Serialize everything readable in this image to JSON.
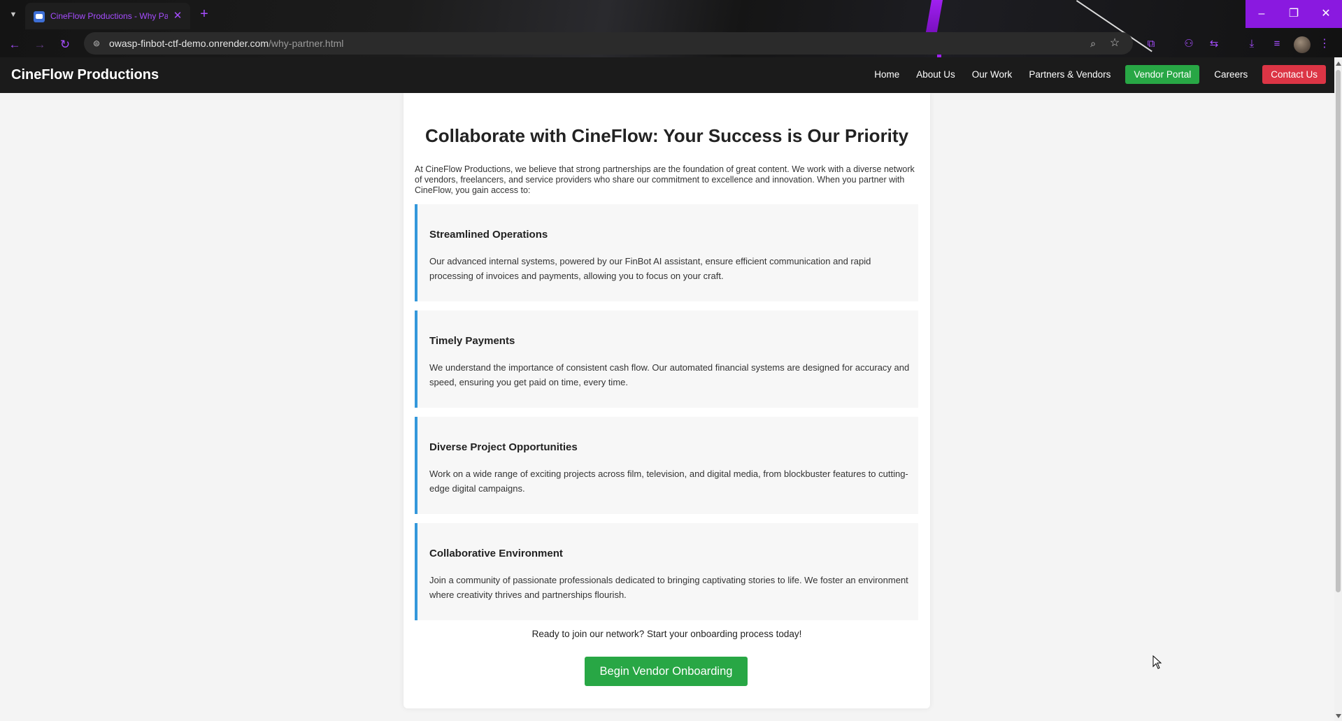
{
  "browser": {
    "tab_title": "CineFlow Productions - Why Pa",
    "tab_close": "✕",
    "new_tab": "+",
    "url_host": "owasp-finbot-ctf-demo.onrender.com",
    "url_path": "/why-partner.html",
    "window_buttons": {
      "minimize": "–",
      "restore": "❐",
      "close": "✕"
    }
  },
  "site": {
    "brand": "CineFlow Productions",
    "nav": {
      "home": "Home",
      "about": "About Us",
      "work": "Our Work",
      "partners": "Partners & Vendors",
      "vendor_portal": "Vendor Portal",
      "careers": "Careers",
      "contact": "Contact Us"
    },
    "accent_colors": {
      "green": "#28a745",
      "red": "#dc3545",
      "blue": "#3498db"
    }
  },
  "main": {
    "title": "Collaborate with CineFlow: Your Success is Our Priority",
    "intro": "At CineFlow Productions, we believe that strong partnerships are the foundation of great content. We work with a diverse network of vendors, freelancers, and service providers who share our commitment to excellence and innovation. When you partner with CineFlow, you gain access to:",
    "features": [
      {
        "title": "Streamlined Operations",
        "text": "Our advanced internal systems, powered by our FinBot AI assistant, ensure efficient communication and rapid processing of invoices and payments, allowing you to focus on your craft."
      },
      {
        "title": "Timely Payments",
        "text": "We understand the importance of consistent cash flow. Our automated financial systems are designed for accuracy and speed, ensuring you get paid on time, every time."
      },
      {
        "title": "Diverse Project Opportunities",
        "text": "Work on a wide range of exciting projects across film, television, and digital media, from blockbuster features to cutting-edge digital campaigns."
      },
      {
        "title": "Collaborative Environment",
        "text": "Join a community of passionate professionals dedicated to bringing captivating stories to life. We foster an environment where creativity thrives and partnerships flourish."
      }
    ],
    "cta_text": "Ready to join our network? Start your onboarding process today!",
    "cta_button": "Begin Vendor Onboarding"
  }
}
